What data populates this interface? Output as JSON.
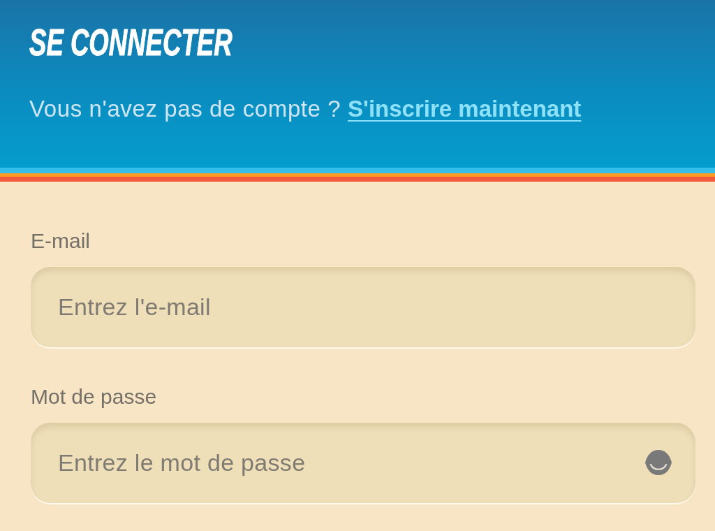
{
  "header": {
    "title": "SE CONNECTER",
    "prompt": "Vous n'avez pas de compte ?",
    "link": "S'inscrire maintenant"
  },
  "fields": [
    {
      "kind": "email",
      "label": "E-mail",
      "placeholder": "Entrez l'e-mail"
    },
    {
      "kind": "password",
      "label": "Mot de passe",
      "placeholder": "Entrez le mot de passe"
    }
  ]
}
